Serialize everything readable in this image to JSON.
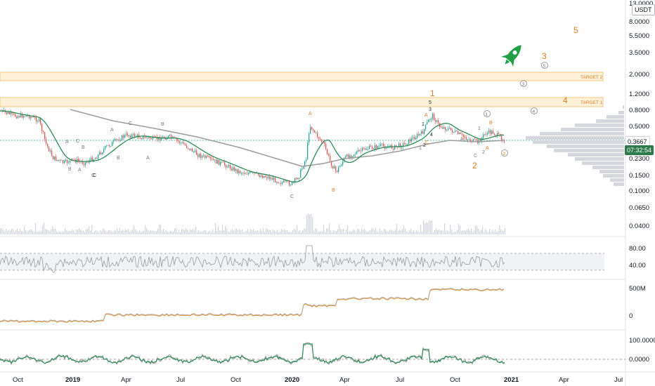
{
  "header": {
    "currency": "USDT"
  },
  "price_axis": {
    "labels": [
      "13.0000",
      "8.0000",
      "5.5000",
      "3.5000",
      "2.0000",
      "1.2000",
      "0.8000",
      "0.5000",
      "0.3667",
      "0.2300",
      "0.1500",
      "0.1000",
      "0.0650",
      "0.0400"
    ],
    "current_price": "0.3667",
    "countdown": "07:32:54"
  },
  "time_axis": {
    "labels": [
      "Oct",
      "2019",
      "Apr",
      "Jul",
      "Oct",
      "2020",
      "Apr",
      "Jul",
      "Oct",
      "2021",
      "Apr",
      "Jul"
    ]
  },
  "targets": {
    "target1": "TARGET 1",
    "target2": "TARGET 2"
  },
  "rsi_axis": {
    "labels": [
      "80.00",
      "40.00"
    ]
  },
  "obv_axis": {
    "labels": [
      "500M",
      "0"
    ]
  },
  "osc_axis": {
    "labels": [
      "100.0000",
      "0.0000"
    ]
  },
  "wave_labels": {
    "orange": [
      "1",
      "2",
      "3",
      "4",
      "5",
      "A",
      "B",
      "C",
      "A",
      "B",
      "A",
      "2"
    ],
    "gray": [
      "A",
      "C",
      "B",
      "B",
      "A",
      "C",
      "A",
      "B",
      "C",
      "B",
      "A",
      "C",
      "C",
      "1",
      "A",
      "2",
      "1"
    ],
    "black": [
      "5",
      "3",
      "1",
      "2",
      "4",
      "C"
    ],
    "circled": [
      "5",
      "3",
      "4",
      "2",
      "1"
    ]
  },
  "colors": {
    "candle_up": "#26a69a",
    "candle_down": "#ef5350",
    "ma_fast": "#2e8b57",
    "ma_slow": "#9e9e9e",
    "wave_orange": "#e07b22",
    "rocket": "#1fa047",
    "target_band": "#fbe7c0"
  },
  "icons": {
    "rocket": "rocket-icon"
  }
}
